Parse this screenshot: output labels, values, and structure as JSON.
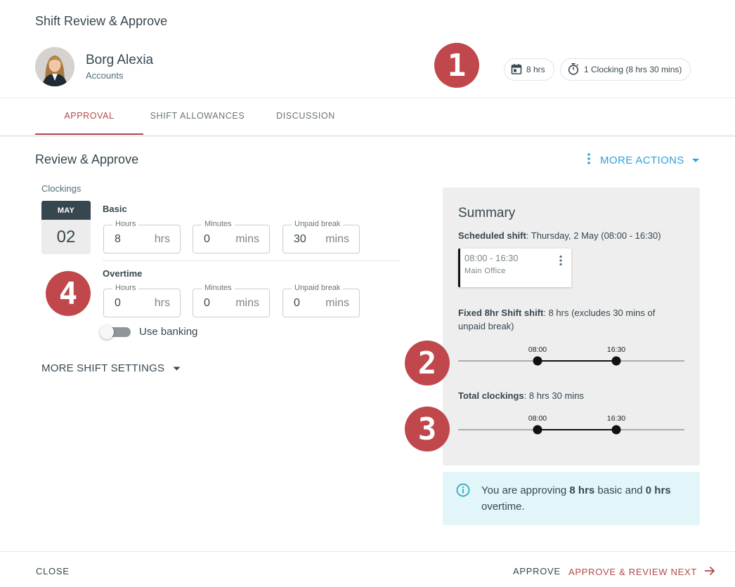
{
  "dialog": {
    "title": "Shift Review & Approve"
  },
  "employee": {
    "name": "Borg Alexia",
    "department": "Accounts"
  },
  "markers": [
    "1",
    "2",
    "3",
    "4"
  ],
  "chips": {
    "scheduled": "8 hrs",
    "clocking": "1 Clocking (8 hrs 30 mins)"
  },
  "tabs": [
    {
      "label": "APPROVAL",
      "active": true
    },
    {
      "label": "SHIFT ALLOWANCES",
      "active": false
    },
    {
      "label": "DISCUSSION",
      "active": false
    }
  ],
  "section": {
    "title": "Review & Approve",
    "more_actions": "MORE ACTIONS"
  },
  "clockings": {
    "label": "Clockings",
    "month": "MAY",
    "day": "02",
    "basic": {
      "label": "Basic",
      "hours": {
        "label": "Hours",
        "value": "8",
        "unit": "hrs"
      },
      "minutes": {
        "label": "Minutes",
        "value": "0",
        "unit": "mins"
      },
      "unpaid_break": {
        "label": "Unpaid break",
        "value": "30",
        "unit": "mins"
      }
    },
    "overtime": {
      "label": "Overtime",
      "hours": {
        "label": "Hours",
        "value": "0",
        "unit": "hrs"
      },
      "minutes": {
        "label": "Minutes",
        "value": "0",
        "unit": "mins"
      },
      "unpaid_break": {
        "label": "Unpaid break",
        "value": "0",
        "unit": "mins"
      }
    },
    "use_banking": {
      "label": "Use banking",
      "enabled": false
    },
    "more_settings": "MORE SHIFT SETTINGS"
  },
  "summary": {
    "title": "Summary",
    "scheduled_label": "Scheduled shift",
    "scheduled_value": ": Thursday, 2 May (08:00 - 16:30)",
    "shift_card": {
      "time": "08:00 - 16:30",
      "location": "Main Office"
    },
    "fixed_label": "Fixed 8hr Shift shift",
    "fixed_value": ": 8 hrs (excludes 30 mins of unpaid break)",
    "fixed_timeline": {
      "start": "08:00",
      "end": "16:30"
    },
    "total_label": "Total clockings",
    "total_value": ": 8 hrs 30 mins",
    "total_timeline": {
      "start": "08:00",
      "end": "16:30"
    }
  },
  "info": {
    "prefix": "You are approving ",
    "basic": "8 hrs",
    "middle": " basic and ",
    "overtime": "0 hrs",
    "suffix": " overtime."
  },
  "footer": {
    "close": "CLOSE",
    "approve": "APPROVE",
    "approve_next": "APPROVE & REVIEW NEXT"
  },
  "colors": {
    "accent": "#b2484a",
    "link": "#2d9fd9",
    "marker": "#c0474b",
    "info_bg": "#e2f6f9"
  }
}
